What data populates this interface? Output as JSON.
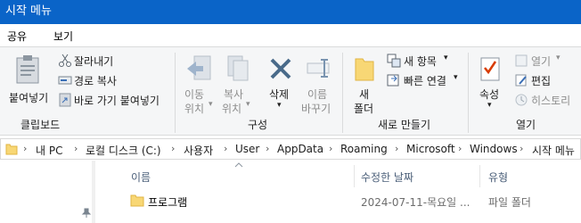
{
  "window": {
    "title": "시작 메뉴"
  },
  "menu": {
    "share": "공유",
    "view": "보기"
  },
  "ribbon": {
    "clipboard": {
      "paste": "붙여넣기",
      "cut": "잘라내기",
      "copy_path": "경로 복사",
      "paste_shortcut": "바로 가기 붙여넣기",
      "group": "클립보드"
    },
    "organize": {
      "move_to_1": "이동",
      "move_to_2": "위치",
      "copy_to_1": "복사",
      "copy_to_2": "위치",
      "delete": "삭제",
      "rename_1": "이름",
      "rename_2": "바꾸기",
      "group": "구성"
    },
    "new": {
      "new_folder_1": "새",
      "new_folder_2": "폴더",
      "new_item": "새 항목",
      "easy_access": "빠른 연결",
      "group": "새로 만들기"
    },
    "open": {
      "properties": "속성",
      "open": "열기",
      "edit": "편집",
      "history": "히스토리",
      "group": "열기"
    }
  },
  "address": {
    "crumbs": [
      "내 PC",
      "로컬 디스크 (C:)",
      "사용자",
      "User",
      "AppData",
      "Roaming",
      "Microsoft",
      "Windows",
      "시작 메뉴"
    ]
  },
  "columns": {
    "name": "이름",
    "modified": "수정한 날짜",
    "type": "유형"
  },
  "rows": [
    {
      "name": "프로그램",
      "modified": "2024-07-11-목요일 ...",
      "type": "파일 폴더"
    }
  ],
  "colors": {
    "titlebar": "#0a64c8",
    "folder": "#f8d775",
    "delete_x": "#4a6b8a",
    "accent_red": "#d83b01"
  }
}
